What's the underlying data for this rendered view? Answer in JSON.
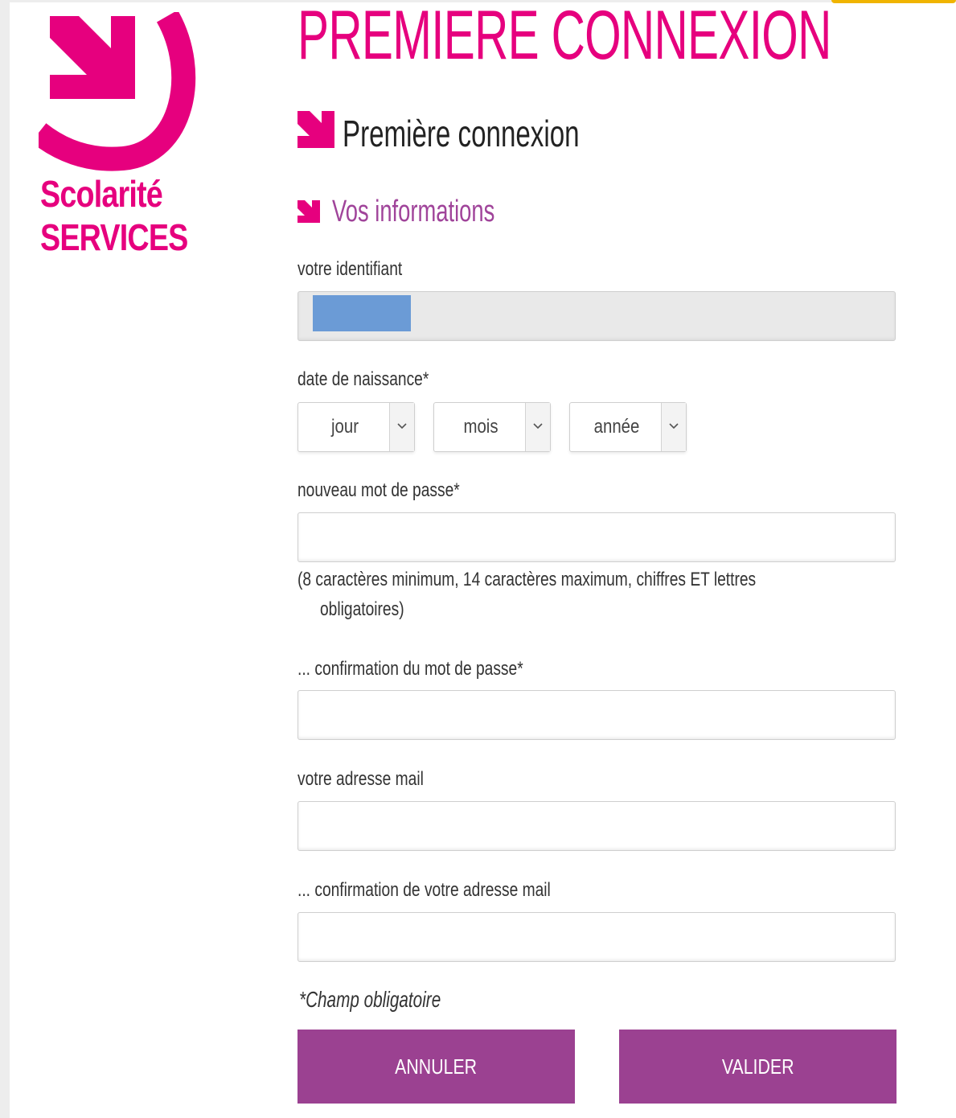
{
  "colors": {
    "brand_pink": "#e6007e",
    "section_purple": "#a0449a",
    "button_purple": "#9b4191",
    "accent_orange": "#f0b400"
  },
  "logo": {
    "icon": "arrow-down-right-icon",
    "line1": "Scolarité",
    "line2": "SERVICES"
  },
  "header": {
    "title": "PREMIERE CONNEXION"
  },
  "section": {
    "icon": "arrow-down-right-icon",
    "title": "Première connexion"
  },
  "subsection": {
    "icon": "arrow-down-right-icon",
    "title": "Vos informations"
  },
  "form": {
    "identifiant": {
      "label": "votre identifiant",
      "value": ""
    },
    "birthdate": {
      "label": "date de naissance*",
      "day": {
        "selected": "jour"
      },
      "month": {
        "selected": "mois"
      },
      "year": {
        "selected": "année"
      }
    },
    "password": {
      "label": "nouveau mot de passe*",
      "value": "",
      "help_line1": "(8 caractères minimum, 14 caractères maximum, chiffres ET lettres",
      "help_line2": "obligatoires)"
    },
    "password_confirm": {
      "label": "... confirmation du mot de passe*",
      "value": ""
    },
    "email": {
      "label": "votre adresse mail",
      "value": ""
    },
    "email_confirm": {
      "label": "... confirmation de votre adresse mail",
      "value": ""
    },
    "mandatory_note": "*Champ obligatoire"
  },
  "buttons": {
    "cancel": "ANNULER",
    "submit": "VALIDER"
  }
}
